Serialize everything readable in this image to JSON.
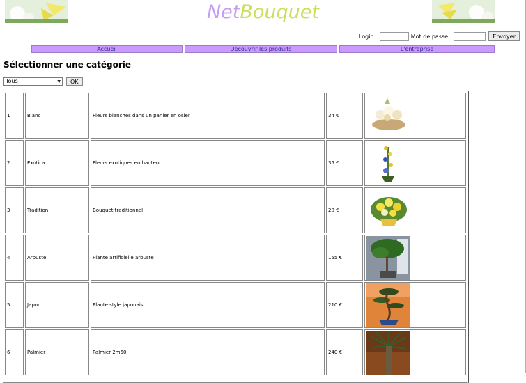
{
  "logo": {
    "part1": "Net",
    "part2": "Bouquet"
  },
  "login": {
    "login_label": "Login :",
    "password_label": "Mot de passe :",
    "submit_label": "Envoyer"
  },
  "nav": [
    {
      "label": "Accueil"
    },
    {
      "label": "Decouvrir les produits"
    },
    {
      "label": "L'entreprise"
    }
  ],
  "heading": "Sélectionner une catégorie",
  "category_select": {
    "value": "Tous",
    "ok_label": "OK"
  },
  "products": [
    {
      "id": "1",
      "name": "Blanc",
      "description": "Fleurs blanches dans un panier en osier",
      "price": "34 €",
      "image": "white-basket-bouquet"
    },
    {
      "id": "2",
      "name": "Exotica",
      "description": "Fleurs exotiques en hauteur",
      "price": "35 €",
      "image": "tall-exotic-flowers"
    },
    {
      "id": "3",
      "name": "Tradition",
      "description": "Bouquet traditionnel",
      "price": "28 €",
      "image": "yellow-round-bouquet"
    },
    {
      "id": "4",
      "name": "Arbuste",
      "description": "Plante artificielle arbuste",
      "price": "155 €",
      "image": "shrub-plant"
    },
    {
      "id": "5",
      "name": "Japon",
      "description": "Plante style japonais",
      "price": "210 €",
      "image": "bonsai-plant"
    },
    {
      "id": "6",
      "name": "Palmier",
      "description": "Palmier 2m50",
      "price": "240 €",
      "image": "palm-tree"
    }
  ]
}
